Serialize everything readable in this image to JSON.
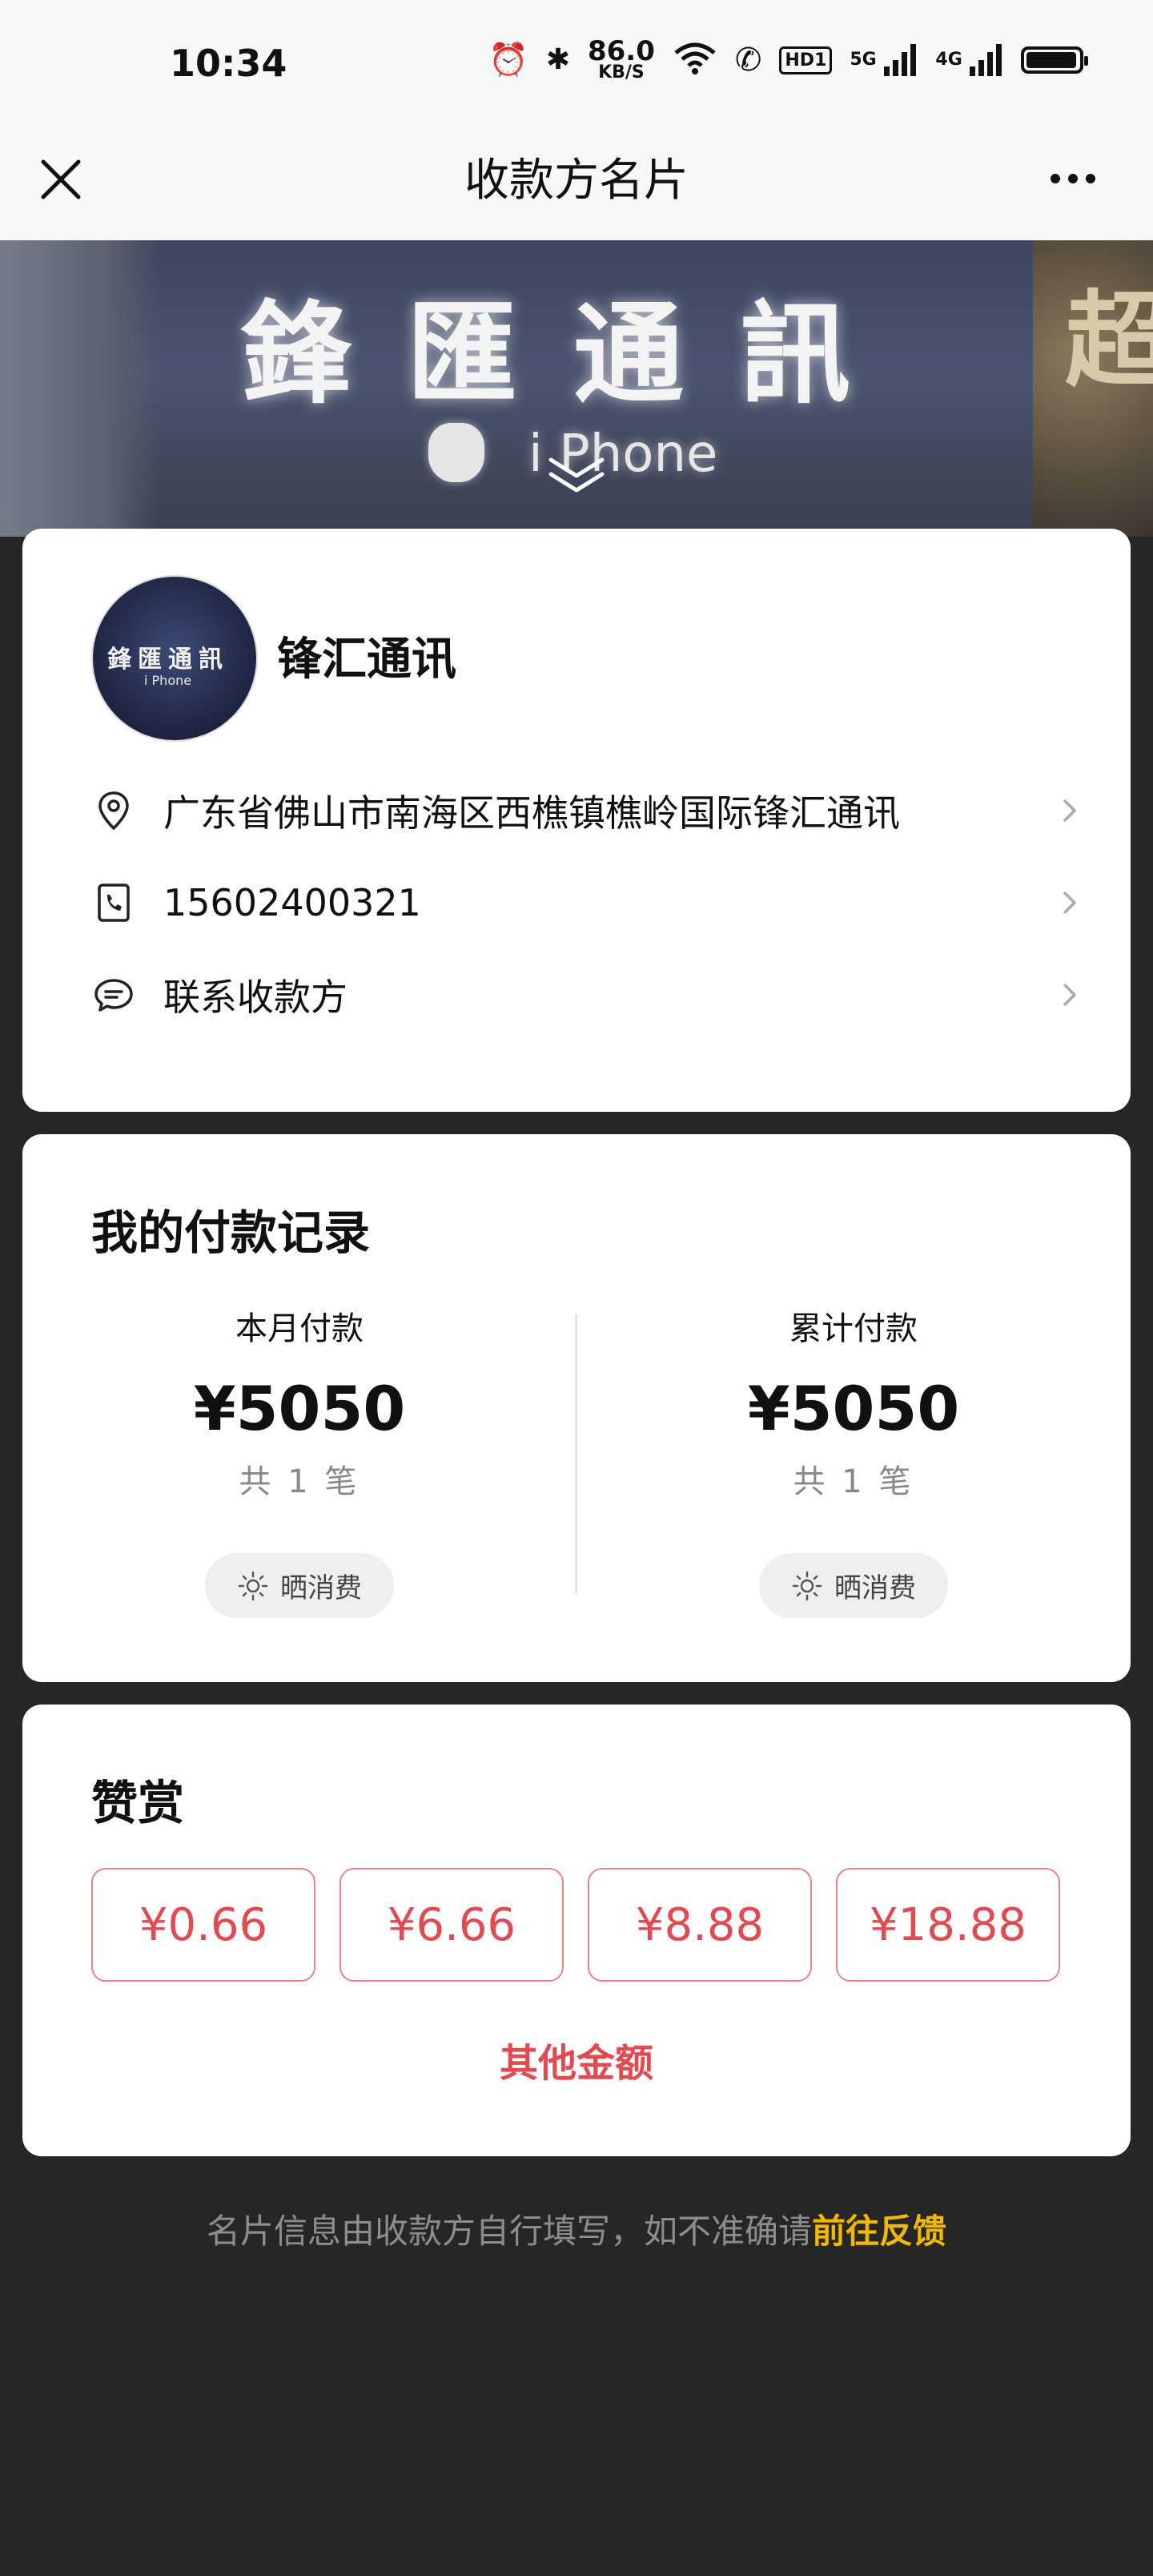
{
  "status_bar": {
    "time": "10:34",
    "net_speed": "86.0",
    "net_unit": "KB/S",
    "hd": "HD1",
    "sig1": "5G",
    "sig2": "4G"
  },
  "nav": {
    "title": "收款方名片"
  },
  "banner": {
    "sign_text": "鋒匯通訊",
    "sub_text": "i Phone",
    "side_char": "超"
  },
  "merchant": {
    "name": "锋汇通讯",
    "address": "广东省佛山市南海区西樵镇樵岭国际锋汇通讯",
    "phone": "15602400321",
    "contact_label": "联系收款方"
  },
  "records": {
    "title": "我的付款记录",
    "month": {
      "label": "本月付款",
      "amount": "¥5050",
      "count": "共 1 笔",
      "share": "晒消费"
    },
    "total": {
      "label": "累计付款",
      "amount": "¥5050",
      "count": "共 1 笔",
      "share": "晒消费"
    }
  },
  "reward": {
    "title": "赞赏",
    "amounts": [
      "¥0.66",
      "¥6.66",
      "¥8.88",
      "¥18.88"
    ],
    "other": "其他金额"
  },
  "footer": {
    "note": "名片信息由收款方自行填写，如不准确请",
    "link": "前往反馈"
  },
  "colors": {
    "accent_red": "#e14a50",
    "link_yellow": "#f2b800",
    "background": "#262626"
  }
}
